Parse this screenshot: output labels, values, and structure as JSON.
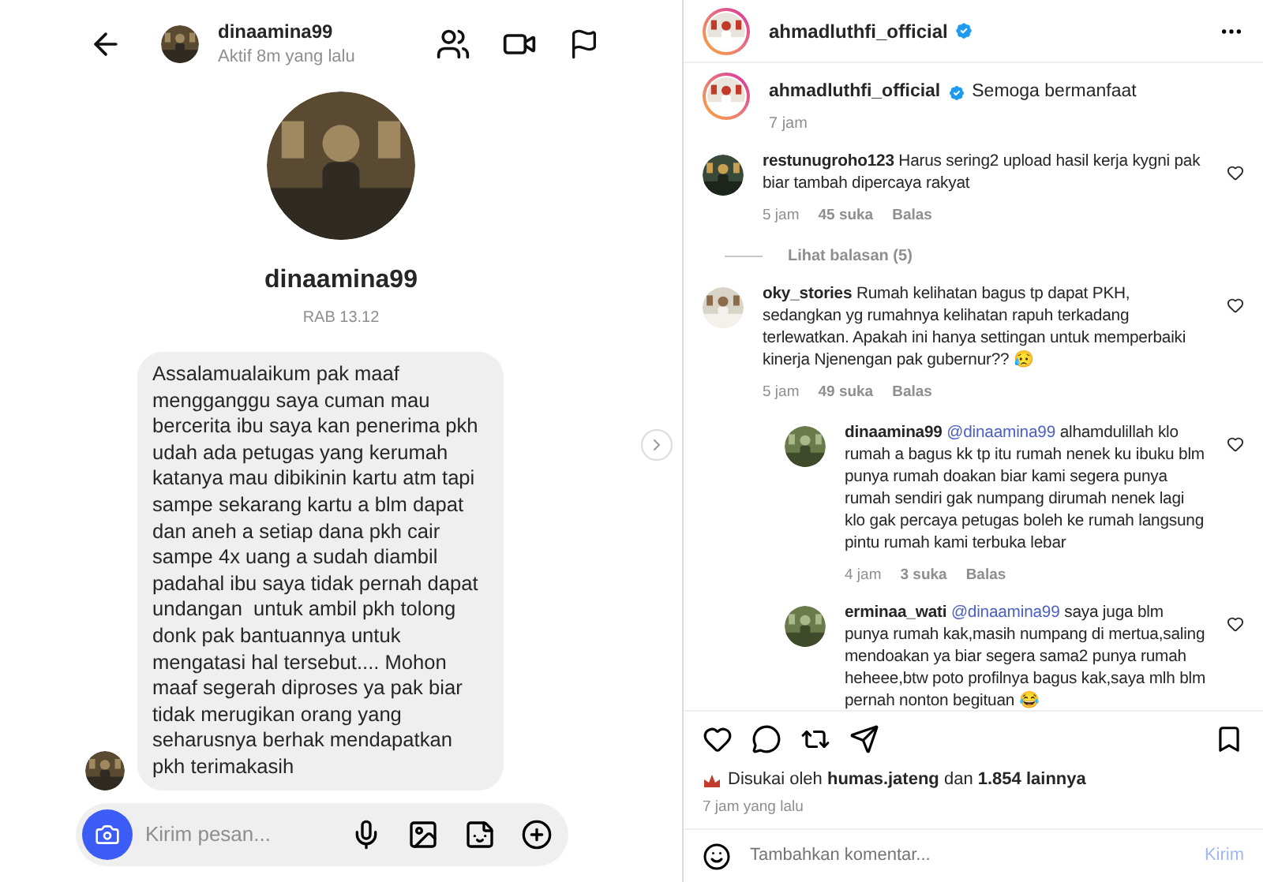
{
  "chat": {
    "header": {
      "username": "dinaamina99",
      "status": "Aktif 8m yang lalu"
    },
    "profile": {
      "username": "dinaamina99",
      "date": "RAB 13.12"
    },
    "message": "Assalamualaikum pak maaf mengganggu saya cuman mau bercerita ibu saya kan penerima pkh udah ada petugas yang kerumah katanya mau dibikinin kartu atm tapi sampe sekarang kartu a blm dapat dan aneh a setiap dana pkh cair sampe 4x uang a sudah diambil padahal ibu saya tidak pernah dapat undangan  untuk ambil pkh tolong donk pak bantuannya untuk mengatasi hal tersebut.... Mohon maaf segerah diproses ya pak biar tidak merugikan orang yang seharusnya berhak mendapatkan pkh terimakasih",
    "composer": {
      "placeholder": "Kirim pesan..."
    }
  },
  "post": {
    "author": "ahmadluthfi_official",
    "verified": true,
    "caption": {
      "user": "ahmadluthfi_official",
      "text": "Semoga bermanfaat",
      "time": "7 jam"
    },
    "comments": [
      {
        "user": "restunugroho123",
        "text": "Harus sering2 upload hasil kerja kygni pak biar tambah dipercaya rakyat",
        "time": "5 jam",
        "likes": "45 suka",
        "reply": "Balas",
        "view_replies": "Lihat balasan (5)"
      },
      {
        "user": "oky_stories",
        "text": "Rumah kelihatan bagus tp dapat PKH, sedangkan yg rumahnya kelihatan rapuh terkadang terlewatkan. Apakah ini hanya settingan untuk memperbaiki kinerja Njenengan pak gubernur?? 😥",
        "time": "5 jam",
        "likes": "49 suka",
        "reply": "Balas",
        "children": [
          {
            "user": "dinaamina99",
            "mention": "@dinaamina99",
            "text": "alhamdulillah klo rumah a bagus kk tp itu rumah nenek ku ibuku blm punya rumah doakan biar kami segera punya rumah sendiri gak numpang dirumah nenek lagi klo gak percaya petugas boleh ke rumah langsung pintu rumah kami terbuka lebar",
            "time": "4 jam",
            "likes": "3 suka",
            "reply": "Balas"
          },
          {
            "user": "erminaa_wati",
            "mention": "@dinaamina99",
            "text": "saya juga blm punya rumah kak,masih numpang di mertua,saling mendoakan ya biar segera sama2 punya rumah heheee,btw poto profilnya bagus kak,saya mlh blm pernah nonton begituan 😂"
          }
        ]
      }
    ],
    "likes": {
      "prefix": "Disukai oleh",
      "user": "humas.jateng",
      "joiner": "dan",
      "count": "1.854 lainnya"
    },
    "time": "7 jam yang lalu",
    "comment_box": {
      "placeholder": "Tambahkan komentar...",
      "submit": "Kirim"
    }
  }
}
